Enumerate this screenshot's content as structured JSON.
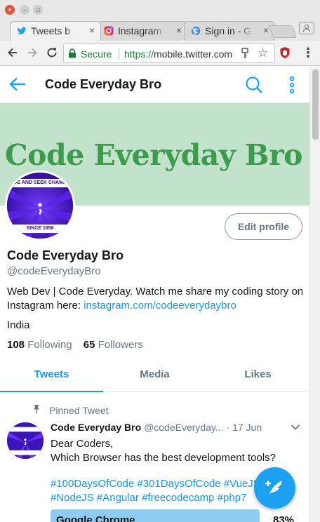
{
  "browser": {
    "tabs": [
      {
        "title": "Tweets b",
        "close": "×"
      },
      {
        "title": "Instagram",
        "close": "×"
      },
      {
        "title": "Sign in - G",
        "close": "×"
      }
    ],
    "address": {
      "secure_label": "Secure",
      "url_proto": "https://",
      "url_rest": "mobile.twitter.com"
    }
  },
  "header": {
    "title": "Code Everyday Bro"
  },
  "banner": {
    "text": "Code Everyday Bro"
  },
  "avatar": {
    "top_text": "IDE AND SEEK CHAMPI",
    "bottom_text": "SINCE 1958"
  },
  "profile": {
    "edit_label": "Edit profile",
    "name": "Code Everyday Bro",
    "handle": "@codeEverydayBro",
    "bio_text": "Web Dev | Code Everyday. Watch me share my coding story on Instagram here: ",
    "bio_link": "instagram.com/codeeverydaybro",
    "location": "India",
    "following_count": "108",
    "following_label": "Following",
    "followers_count": "65",
    "followers_label": "Followers"
  },
  "tabs": [
    {
      "label": "Tweets",
      "active": true
    },
    {
      "label": "Media"
    },
    {
      "label": "Likes"
    }
  ],
  "pinned_label": "Pinned Tweet",
  "tweet": {
    "name": "Code Everyday Bro",
    "handle": "@codeEveryday...",
    "date": "· 17 Jun",
    "line1": "Dear Coders,",
    "line2": "Which Browser has the best development tools?",
    "hashtags": "#100DaysOfCode #301DaysOfCode #VueJS #NodeJS #Angular #freecodecamp #php7",
    "poll_option": "Google Chrome",
    "poll_percent": "83%"
  },
  "colors": {
    "accent": "#1da1f2",
    "banner_bg": "#c2e2cc",
    "banner_text": "#3c9b4c"
  }
}
